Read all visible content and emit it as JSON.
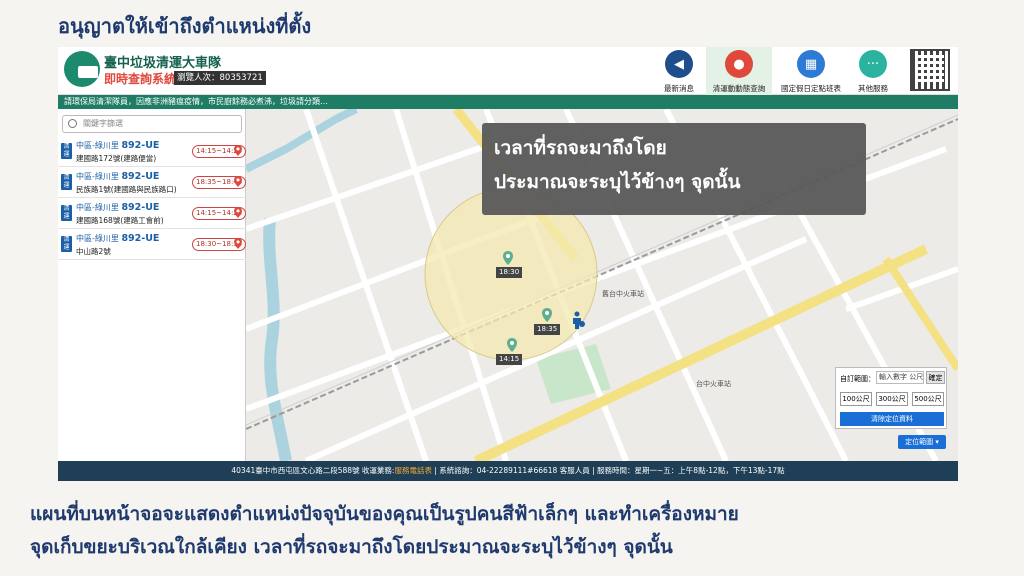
{
  "slide": {
    "title": "อนุญาตให้เข้าถึงตำแหน่งที่ตั้ง",
    "caption_line1": "แผนที่บนหน้าจอจะแสดงตำแหน่งปัจจุบันของคุณเป็นรูปคนสีฟ้าเล็กๆ   และทำเครื่องหมาย",
    "caption_line2": "จุดเก็บขยะบริเวณใกล้เคียง เวลาที่รถจะมาถึงโดยประมาณจะระบุไว้ข้างๆ จุดนั้น"
  },
  "app": {
    "title": "臺中垃圾清運大車隊",
    "subtitle": "即時查詢系統",
    "visitors": "瀏覽人次：80353721",
    "nav": [
      {
        "label": "最新消息",
        "icon": "megaphone-icon",
        "color": "#1e4f8c"
      },
      {
        "label": "清運動動態查詢",
        "icon": "map-pin-icon",
        "color": "#e0483b"
      },
      {
        "label": "國定假日定點班表",
        "icon": "calendar-icon",
        "color": "#2e7bd6"
      },
      {
        "label": "其他服務",
        "icon": "more-icon",
        "color": "#2bb3a0"
      }
    ],
    "marquee": "請環保局清潔隊員，因應非洲豬瘟疫情，市民廚餘務必煮沸，垃圾請分類…",
    "search_placeholder": "關鍵字篩選",
    "routes": [
      {
        "badge": "清運",
        "district": "中區-綠川里",
        "route": "892-UE",
        "address": "建國路172號(建路便當)",
        "time": "14:15~14:25"
      },
      {
        "badge": "清運",
        "district": "中區-綠川里",
        "route": "892-UE",
        "address": "民族路1號(建國路與民族路口)",
        "time": "18:35~18:40"
      },
      {
        "badge": "清運",
        "district": "中區-綠川里",
        "route": "892-UE",
        "address": "建國路168號(建路工會前)",
        "time": "14:15~14:25"
      },
      {
        "badge": "清運",
        "district": "中區-綠川里",
        "route": "892-UE",
        "address": "中山路2號",
        "time": "18:30~18:35"
      }
    ],
    "footer_pre": "40341臺中市西屯區文心路二段588號  收運業務:",
    "footer_hl": "服務電話表",
    "footer_post": "  | 系統諮詢：04-22289111#66618 客服人員 | 服務時間：星期一~五：上午8點-12點，下午13點-17點"
  },
  "map": {
    "markers": [
      {
        "time": "18:30"
      },
      {
        "time": "18:35"
      },
      {
        "time": "14:15"
      }
    ],
    "station1": "舊台中火車站",
    "station2": "台中火車站",
    "tooltip_line1": "เวลาที่รถจะมาถึงโดย",
    "tooltip_line2": "ประมาณจะระบุไว้ข้างๆ จุดนั้น",
    "panel": {
      "label": "自訂範圍：",
      "input_placeholder": "輸入數字 公尺",
      "confirm": "確定",
      "distances": [
        "100公尺",
        "300公尺",
        "500公尺"
      ],
      "clear": "清除定位資料",
      "locate": "定位範圍 ▾"
    },
    "colors": {
      "road": "#ffffff",
      "highway": "#f4e184",
      "river": "#aad3df",
      "park": "#c8e6c9",
      "radius": "#f4eab0"
    }
  }
}
